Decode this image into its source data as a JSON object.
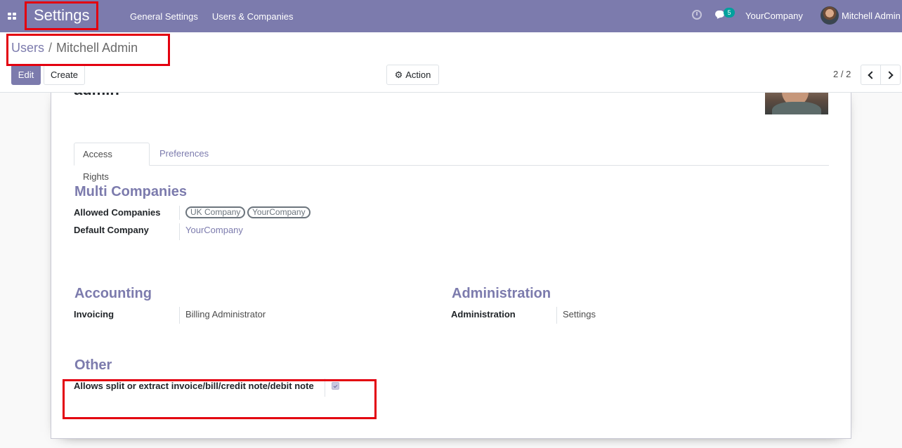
{
  "navbar": {
    "app_title": "Settings",
    "menu": [
      "General Settings",
      "Users & Companies"
    ],
    "activity_icon": "clock-icon",
    "chat_icon": "chat-icon",
    "chat_badge_count": "5",
    "company": "YourCompany",
    "user_name": "Mitchell Admin",
    "background_color": "#7c7bad"
  },
  "breadcrumb": {
    "parent": "Users",
    "separator": "/",
    "current": "Mitchell Admin"
  },
  "toolbar": {
    "edit_label": "Edit",
    "create_label": "Create",
    "action_label": "Action",
    "action_icon": "gear-icon",
    "pager": "2 / 2"
  },
  "record": {
    "name": "admin"
  },
  "tabs": [
    "Access Rights",
    "Preferences"
  ],
  "sections": {
    "multi_companies": {
      "title": "Multi Companies",
      "allowed_companies_label": "Allowed Companies",
      "allowed_companies": [
        "UK Company",
        "YourCompany"
      ],
      "default_company_label": "Default Company",
      "default_company": "YourCompany"
    },
    "accounting": {
      "title": "Accounting",
      "invoicing_label": "Invoicing",
      "invoicing_value": "Billing Administrator"
    },
    "administration": {
      "title": "Administration",
      "administration_label": "Administration",
      "administration_value": "Settings"
    },
    "other": {
      "title": "Other",
      "split_invoice_label": "Allows split or extract invoice/bill/credit note/debit note",
      "split_invoice_checked": true
    }
  },
  "colors": {
    "accent": "#7c7bad",
    "highlight": "#e3000f"
  }
}
